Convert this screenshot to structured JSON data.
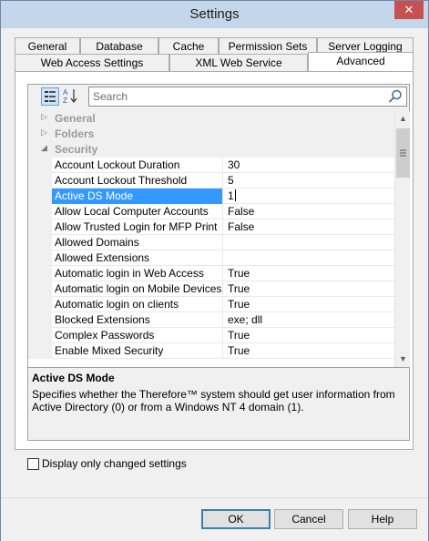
{
  "window": {
    "title": "Settings",
    "close_glyph": "✕"
  },
  "tabs_row1": [
    {
      "label": "General"
    },
    {
      "label": "Database"
    },
    {
      "label": "Cache"
    },
    {
      "label": "Permission Sets"
    },
    {
      "label": "Server Logging"
    }
  ],
  "tabs_row2": [
    {
      "label": "Web Access Settings"
    },
    {
      "label": "XML Web Service"
    },
    {
      "label": "Advanced"
    }
  ],
  "toolbar": {
    "categorized_icon": "categorized-icon",
    "alphabetical_icon": "sort-alphabetical-icon",
    "search_placeholder": "Search",
    "search_icon": "search-icon"
  },
  "categories": [
    {
      "label": "General",
      "state": "collapsed"
    },
    {
      "label": "Folders",
      "state": "collapsed"
    },
    {
      "label": "Security",
      "state": "expanded"
    }
  ],
  "properties": [
    {
      "name": "Account Lockout Duration",
      "value": "30"
    },
    {
      "name": "Account Lockout Threshold",
      "value": "5"
    },
    {
      "name": "Active DS Mode",
      "value": "1",
      "selected": true
    },
    {
      "name": "Allow Local Computer Accounts",
      "value": "False"
    },
    {
      "name": "Allow Trusted Login for MFP Print",
      "value": "False"
    },
    {
      "name": "Allowed Domains",
      "value": ""
    },
    {
      "name": "Allowed Extensions",
      "value": ""
    },
    {
      "name": "Automatic login in Web Access",
      "value": "True"
    },
    {
      "name": "Automatic login on Mobile Devices",
      "value": "True"
    },
    {
      "name": "Automatic login on clients",
      "value": "True"
    },
    {
      "name": "Blocked Extensions",
      "value": "exe; dll"
    },
    {
      "name": "Complex Passwords",
      "value": "True"
    },
    {
      "name": "Enable Mixed Security",
      "value": "True"
    }
  ],
  "help": {
    "title": "Active DS Mode",
    "description": "Specifies whether the Therefore™ system should get user information from Active Directory (0) or from a Windows NT 4 domain (1)."
  },
  "options": {
    "display_changed_label": "Display only changed settings",
    "display_changed_checked": false
  },
  "buttons": {
    "ok": "OK",
    "cancel": "Cancel",
    "help": "Help"
  },
  "colors": {
    "selection": "#3399ff",
    "titlebar": "#c4d7ea",
    "close": "#c75050"
  }
}
